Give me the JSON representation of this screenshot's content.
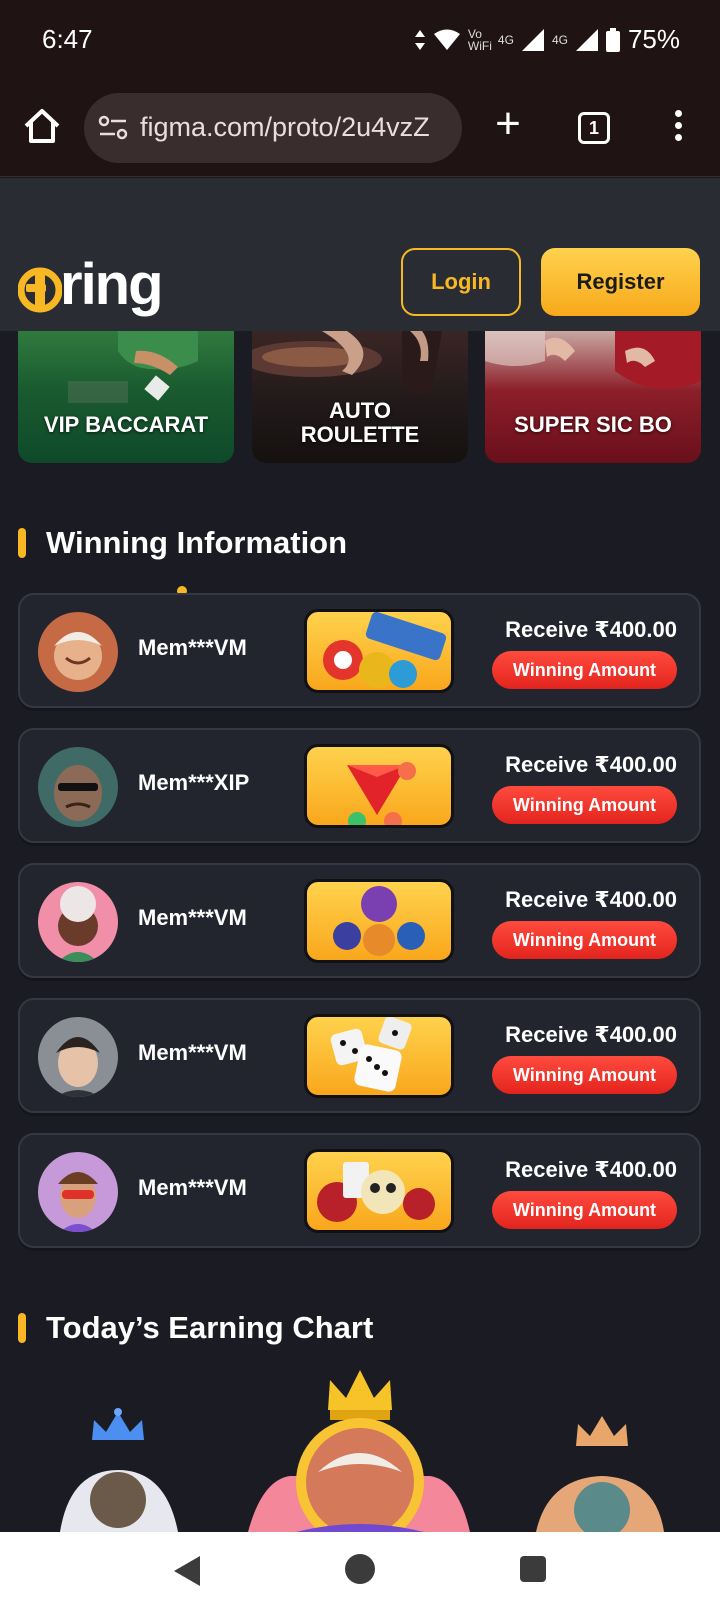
{
  "status_bar": {
    "time": "6:47",
    "wifi_label": "Vo WiFi",
    "network_1": "4G",
    "network_2": "4G",
    "battery": "75%"
  },
  "browser": {
    "url": "figma.com/proto/2u4vzZ",
    "tab_count": "1",
    "new_tab_symbol": "+"
  },
  "header": {
    "logo_text": "ring",
    "login_label": "Login",
    "register_label": "Register",
    "brand_color": "#f8b824"
  },
  "game_cards": [
    {
      "label": "VIP BACCARAT"
    },
    {
      "label": "AUTO ROULETTE"
    },
    {
      "label": "SUPER SIC BO"
    }
  ],
  "winning": {
    "title": "Winning Information",
    "rows": [
      {
        "member": "Mem***VM",
        "receive": "Receive ₹400.00",
        "badge": "Winning Amount",
        "game_icon": "lottery-balls-icon"
      },
      {
        "member": "Mem***XIP",
        "receive": "Receive ₹400.00",
        "badge": "Winning Amount",
        "game_icon": "red-gem-icon"
      },
      {
        "member": "Mem***VM",
        "receive": "Receive ₹400.00",
        "badge": "Winning Amount",
        "game_icon": "characters-icon"
      },
      {
        "member": "Mem***VM",
        "receive": "Receive ₹400.00",
        "badge": "Winning Amount",
        "game_icon": "dice-icon"
      },
      {
        "member": "Mem***VM",
        "receive": "Receive ₹400.00",
        "badge": "Winning Amount",
        "game_icon": "panda-icon"
      }
    ]
  },
  "earning": {
    "title": "Today’s Earning Chart"
  },
  "colors": {
    "badge_red": "#e3241e",
    "background": "#1b1c23"
  }
}
